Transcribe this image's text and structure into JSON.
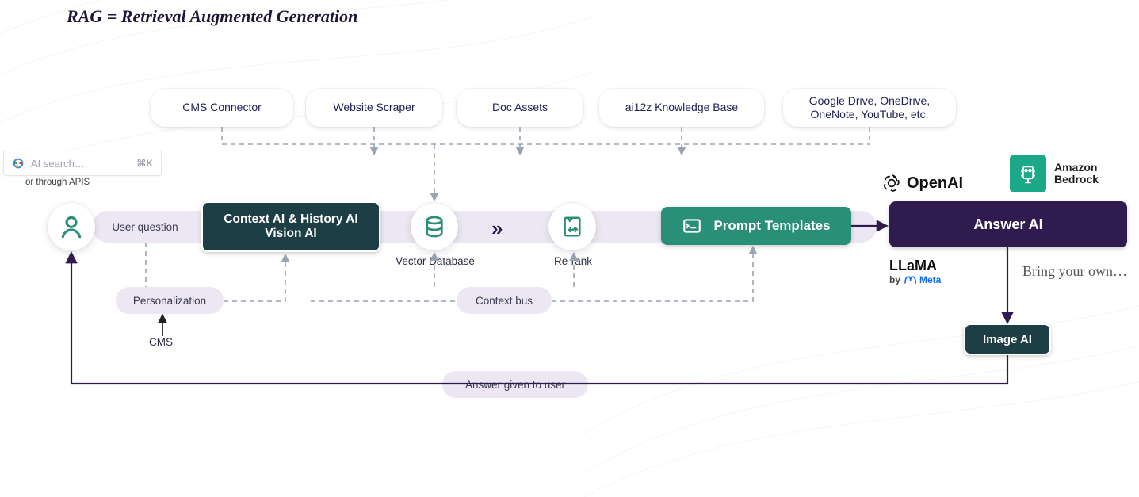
{
  "title": "RAG = Retrieval Augmented Generation",
  "search": {
    "placeholder": "AI search…",
    "kbd": "⌘K",
    "sub": "or through APIS"
  },
  "sources": {
    "cms": "CMS Connector",
    "scraper": "Website Scraper",
    "docs": "Doc Assets",
    "kb": "ai12z Knowledge Base",
    "drives": "Google Drive, OneDrive, OneNote, YouTube, etc."
  },
  "flow": {
    "user_question": "User question",
    "context_line1": "Context AI & History AI",
    "context_line2": "Vision AI",
    "vector_db": "Vector Database",
    "rerank": "Re-rank",
    "prompt_templates": "Prompt Templates",
    "answer_ai": "Answer AI",
    "image_ai": "Image AI"
  },
  "bus": {
    "personalization": "Personalization",
    "context_bus": "Context bus",
    "cms": "CMS",
    "answer_user": "Answer given to user"
  },
  "providers": {
    "openai": "OpenAI",
    "bedrock1": "Amazon",
    "bedrock2": "Bedrock",
    "llama": "LLaMA",
    "llama_by": "by",
    "llama_meta": "Meta",
    "byo": "Bring your own…"
  },
  "colors": {
    "teal": "#2a8f79",
    "darkTeal": "#1e3e45",
    "purple": "#2f1b4e",
    "pill": "#ece7f2",
    "text_serif": "#1f1f56"
  }
}
